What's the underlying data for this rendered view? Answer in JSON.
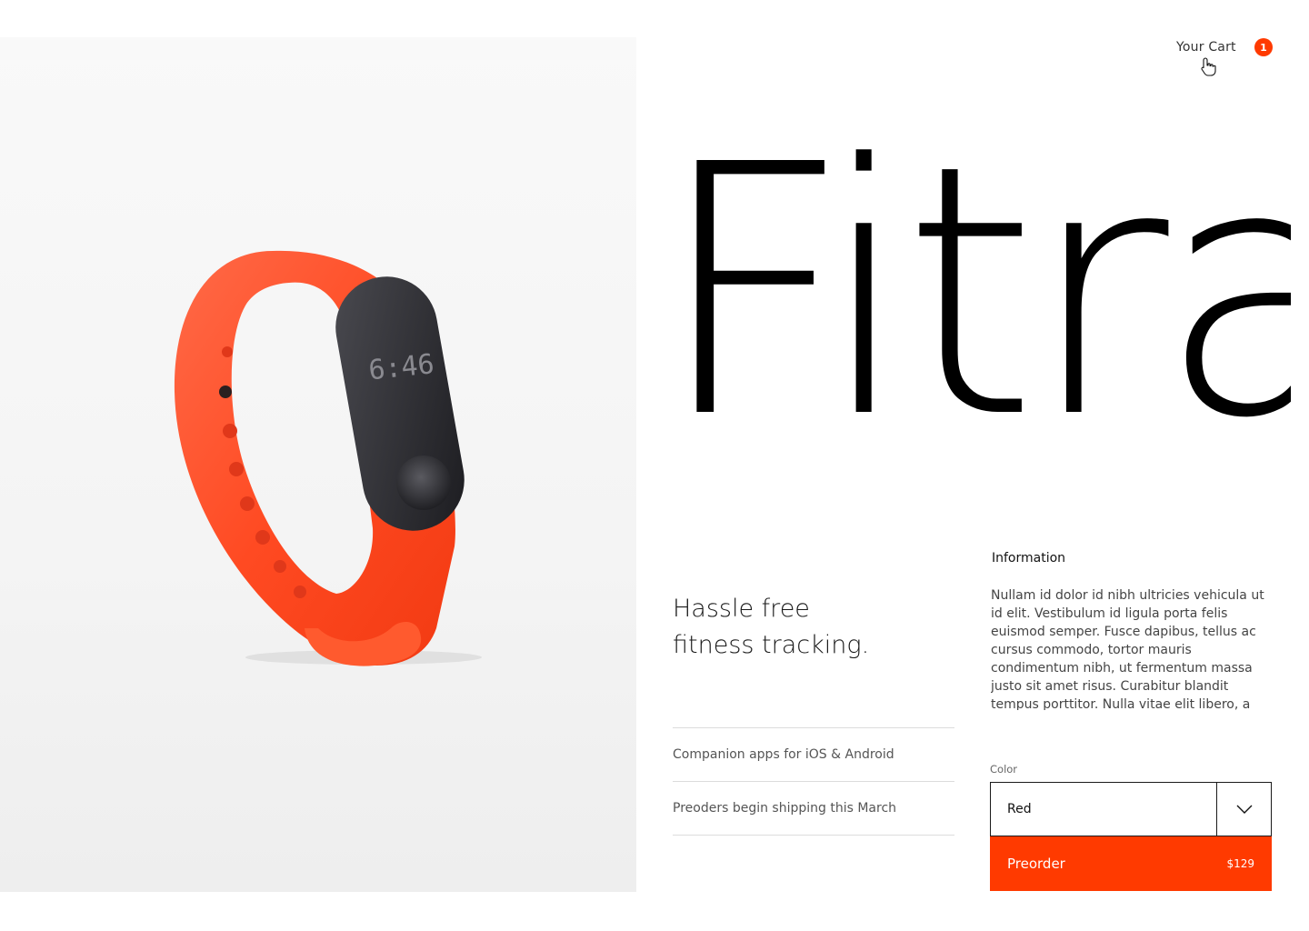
{
  "header": {
    "cart_label": "Your Cart",
    "cart_count": "1"
  },
  "product": {
    "name": "Fitra",
    "tagline_line1": "Hassle free",
    "tagline_line2": "fitness tracking.",
    "display_time": "6:46",
    "features": [
      "Companion apps for iOS & Android",
      "Preoders begin shipping this March"
    ]
  },
  "information": {
    "heading": "Information",
    "body": "Nullam id dolor id nibh ultricies vehicula ut id elit. Vestibulum id ligula porta felis euismod semper. Fusce dapibus, tellus ac cursus commodo, tortor mauris condimentum nibh, ut fermentum massa justo sit amet risus. Curabitur blandit tempus porttitor. Nulla vitae elit libero, a"
  },
  "purchase": {
    "color_label": "Color",
    "color_value": "Red",
    "preorder_label": "Preorder",
    "price": "$129"
  },
  "colors": {
    "accent": "#ff3a00",
    "badge": "#ff3a00",
    "band": "#ff4a22",
    "text": "#111111"
  },
  "icons": {
    "cart_cursor": "hand-pointer-icon",
    "select_chevron": "chevron-down-icon"
  }
}
